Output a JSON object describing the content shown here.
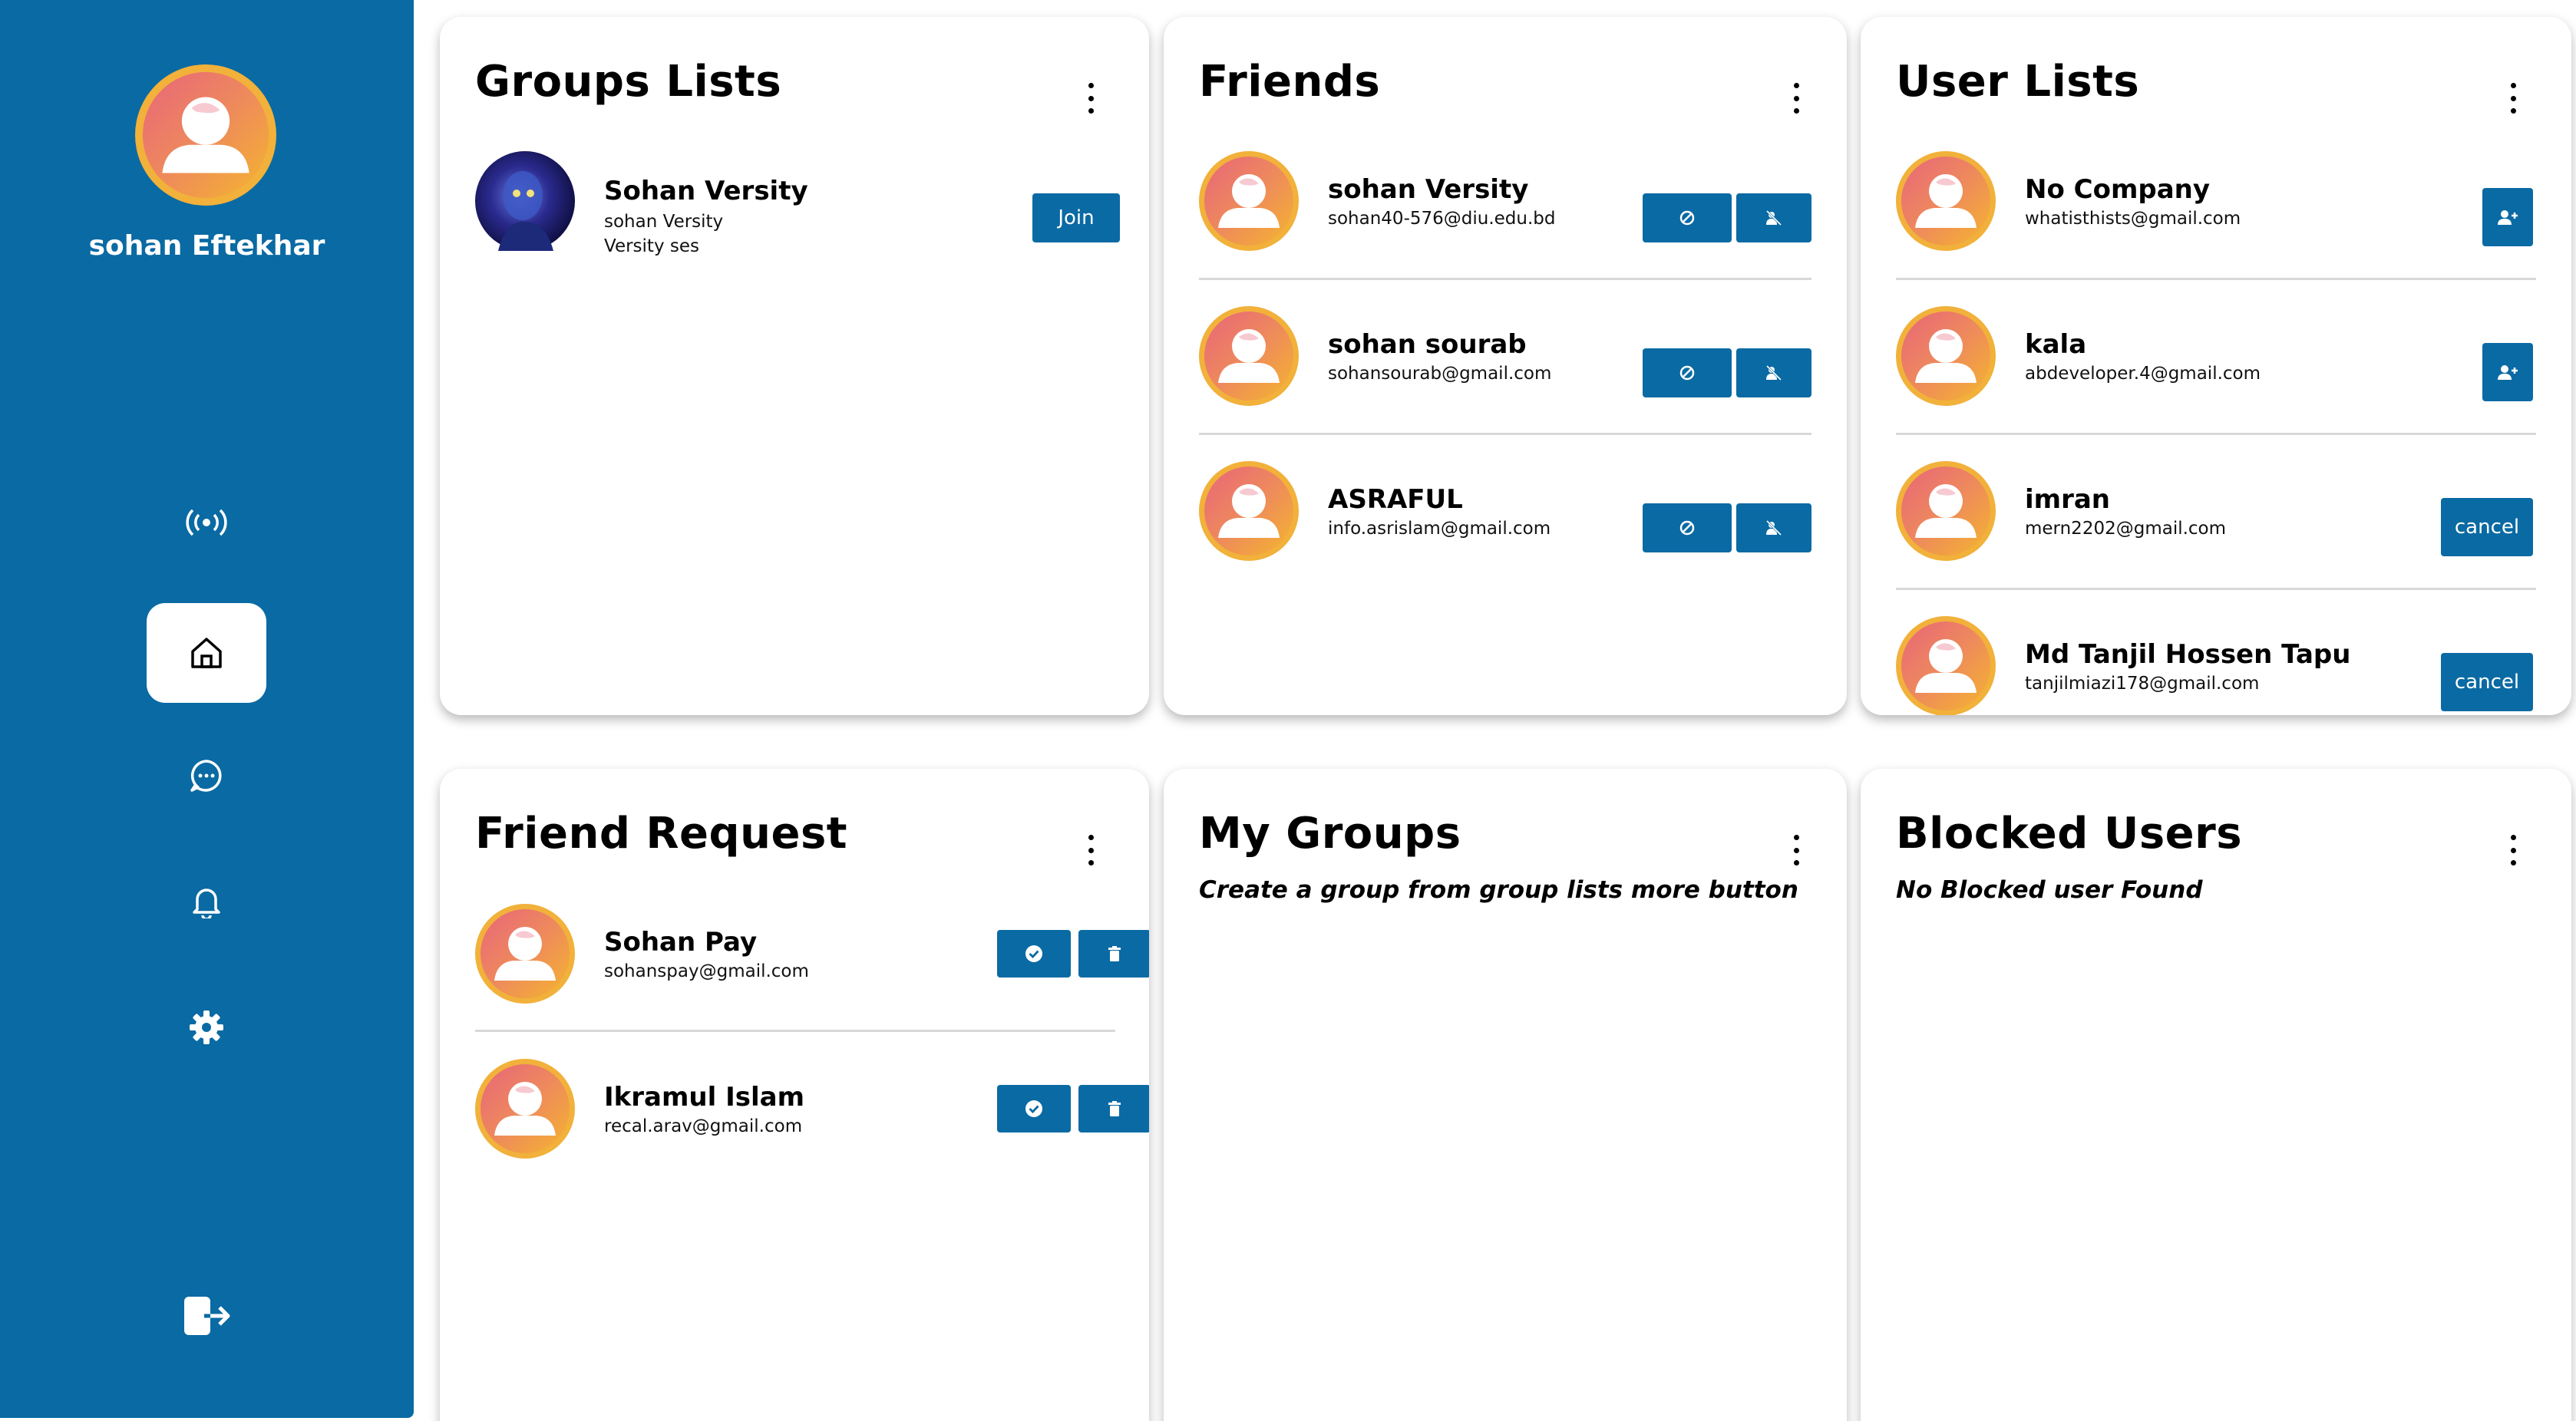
{
  "user": {
    "name": "sohan Eftekhar"
  },
  "colors": {
    "primary": "#0a6aa3",
    "avatar_gradient_start": "#f5a623",
    "avatar_gradient_end": "#e8657a"
  },
  "nav": [
    {
      "icon": "broadcast-icon"
    },
    {
      "icon": "home-icon",
      "active": true
    },
    {
      "icon": "chat-icon"
    },
    {
      "icon": "bell-icon"
    },
    {
      "icon": "settings-icon"
    }
  ],
  "logout_icon": "logout-icon",
  "groups_lists": {
    "title": "Groups Lists",
    "items": [
      {
        "name": "Sohan Versity",
        "subtitle": "sohan Versity",
        "tag": "Versity ses",
        "button": "Join"
      }
    ]
  },
  "friends": {
    "title": "Friends",
    "items": [
      {
        "name": "sohan Versity",
        "email": "sohan40-576@diu.edu.bd"
      },
      {
        "name": "sohan sourab",
        "email": "sohansourab@gmail.com"
      },
      {
        "name": "ASRAFUL",
        "email": "info.asrislam@gmail.com"
      }
    ]
  },
  "user_lists": {
    "title": "User Lists",
    "items": [
      {
        "name": "No Company",
        "email": "whatisthists@gmail.com",
        "action": "add"
      },
      {
        "name": "kala",
        "email": "abdeveloper.4@gmail.com",
        "action": "add"
      },
      {
        "name": "imran",
        "email": "mern2202@gmail.com",
        "action": "cancel"
      },
      {
        "name": "Md Tanjil Hossen Tapu",
        "email": "tanjilmiazi178@gmail.com",
        "action": "cancel"
      }
    ],
    "cancel_label": "cancel"
  },
  "friend_request": {
    "title": "Friend Request",
    "items": [
      {
        "name": "Sohan Pay",
        "email": "sohanspay@gmail.com"
      },
      {
        "name": "Ikramul Islam",
        "email": "recal.arav@gmail.com"
      }
    ]
  },
  "my_groups": {
    "title": "My Groups",
    "empty_message": "Create a group from group lists more button"
  },
  "blocked_users": {
    "title": "Blocked Users",
    "empty_message": "No Blocked user Found"
  }
}
